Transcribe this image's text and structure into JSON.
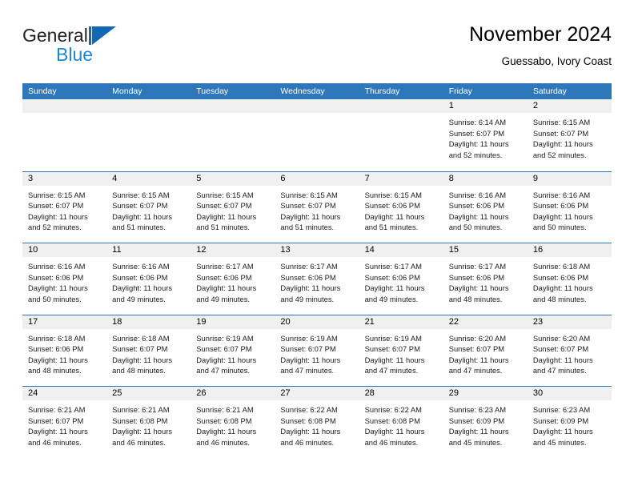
{
  "brand": {
    "name_part1": "General",
    "name_part2": "Blue",
    "logo_icon": "general-blue-triangle-logo",
    "accent_color": "#1268b3",
    "secondary_color": "#1e87d6"
  },
  "header": {
    "title": "November 2024",
    "subtitle": "Guessabo, Ivory Coast"
  },
  "calendar": {
    "header_bg": "#2e77bb",
    "header_text_color": "#ffffff",
    "datenum_bg": "#f0f0f0",
    "weekdays": [
      "Sunday",
      "Monday",
      "Tuesday",
      "Wednesday",
      "Thursday",
      "Friday",
      "Saturday"
    ],
    "weeks": [
      [
        {
          "day": "",
          "lines": []
        },
        {
          "day": "",
          "lines": []
        },
        {
          "day": "",
          "lines": []
        },
        {
          "day": "",
          "lines": []
        },
        {
          "day": "",
          "lines": []
        },
        {
          "day": "1",
          "lines": [
            "Sunrise: 6:14 AM",
            "Sunset: 6:07 PM",
            "Daylight: 11 hours",
            "and 52 minutes."
          ]
        },
        {
          "day": "2",
          "lines": [
            "Sunrise: 6:15 AM",
            "Sunset: 6:07 PM",
            "Daylight: 11 hours",
            "and 52 minutes."
          ]
        }
      ],
      [
        {
          "day": "3",
          "lines": [
            "Sunrise: 6:15 AM",
            "Sunset: 6:07 PM",
            "Daylight: 11 hours",
            "and 52 minutes."
          ]
        },
        {
          "day": "4",
          "lines": [
            "Sunrise: 6:15 AM",
            "Sunset: 6:07 PM",
            "Daylight: 11 hours",
            "and 51 minutes."
          ]
        },
        {
          "day": "5",
          "lines": [
            "Sunrise: 6:15 AM",
            "Sunset: 6:07 PM",
            "Daylight: 11 hours",
            "and 51 minutes."
          ]
        },
        {
          "day": "6",
          "lines": [
            "Sunrise: 6:15 AM",
            "Sunset: 6:07 PM",
            "Daylight: 11 hours",
            "and 51 minutes."
          ]
        },
        {
          "day": "7",
          "lines": [
            "Sunrise: 6:15 AM",
            "Sunset: 6:06 PM",
            "Daylight: 11 hours",
            "and 51 minutes."
          ]
        },
        {
          "day": "8",
          "lines": [
            "Sunrise: 6:16 AM",
            "Sunset: 6:06 PM",
            "Daylight: 11 hours",
            "and 50 minutes."
          ]
        },
        {
          "day": "9",
          "lines": [
            "Sunrise: 6:16 AM",
            "Sunset: 6:06 PM",
            "Daylight: 11 hours",
            "and 50 minutes."
          ]
        }
      ],
      [
        {
          "day": "10",
          "lines": [
            "Sunrise: 6:16 AM",
            "Sunset: 6:06 PM",
            "Daylight: 11 hours",
            "and 50 minutes."
          ]
        },
        {
          "day": "11",
          "lines": [
            "Sunrise: 6:16 AM",
            "Sunset: 6:06 PM",
            "Daylight: 11 hours",
            "and 49 minutes."
          ]
        },
        {
          "day": "12",
          "lines": [
            "Sunrise: 6:17 AM",
            "Sunset: 6:06 PM",
            "Daylight: 11 hours",
            "and 49 minutes."
          ]
        },
        {
          "day": "13",
          "lines": [
            "Sunrise: 6:17 AM",
            "Sunset: 6:06 PM",
            "Daylight: 11 hours",
            "and 49 minutes."
          ]
        },
        {
          "day": "14",
          "lines": [
            "Sunrise: 6:17 AM",
            "Sunset: 6:06 PM",
            "Daylight: 11 hours",
            "and 49 minutes."
          ]
        },
        {
          "day": "15",
          "lines": [
            "Sunrise: 6:17 AM",
            "Sunset: 6:06 PM",
            "Daylight: 11 hours",
            "and 48 minutes."
          ]
        },
        {
          "day": "16",
          "lines": [
            "Sunrise: 6:18 AM",
            "Sunset: 6:06 PM",
            "Daylight: 11 hours",
            "and 48 minutes."
          ]
        }
      ],
      [
        {
          "day": "17",
          "lines": [
            "Sunrise: 6:18 AM",
            "Sunset: 6:06 PM",
            "Daylight: 11 hours",
            "and 48 minutes."
          ]
        },
        {
          "day": "18",
          "lines": [
            "Sunrise: 6:18 AM",
            "Sunset: 6:07 PM",
            "Daylight: 11 hours",
            "and 48 minutes."
          ]
        },
        {
          "day": "19",
          "lines": [
            "Sunrise: 6:19 AM",
            "Sunset: 6:07 PM",
            "Daylight: 11 hours",
            "and 47 minutes."
          ]
        },
        {
          "day": "20",
          "lines": [
            "Sunrise: 6:19 AM",
            "Sunset: 6:07 PM",
            "Daylight: 11 hours",
            "and 47 minutes."
          ]
        },
        {
          "day": "21",
          "lines": [
            "Sunrise: 6:19 AM",
            "Sunset: 6:07 PM",
            "Daylight: 11 hours",
            "and 47 minutes."
          ]
        },
        {
          "day": "22",
          "lines": [
            "Sunrise: 6:20 AM",
            "Sunset: 6:07 PM",
            "Daylight: 11 hours",
            "and 47 minutes."
          ]
        },
        {
          "day": "23",
          "lines": [
            "Sunrise: 6:20 AM",
            "Sunset: 6:07 PM",
            "Daylight: 11 hours",
            "and 47 minutes."
          ]
        }
      ],
      [
        {
          "day": "24",
          "lines": [
            "Sunrise: 6:21 AM",
            "Sunset: 6:07 PM",
            "Daylight: 11 hours",
            "and 46 minutes."
          ]
        },
        {
          "day": "25",
          "lines": [
            "Sunrise: 6:21 AM",
            "Sunset: 6:08 PM",
            "Daylight: 11 hours",
            "and 46 minutes."
          ]
        },
        {
          "day": "26",
          "lines": [
            "Sunrise: 6:21 AM",
            "Sunset: 6:08 PM",
            "Daylight: 11 hours",
            "and 46 minutes."
          ]
        },
        {
          "day": "27",
          "lines": [
            "Sunrise: 6:22 AM",
            "Sunset: 6:08 PM",
            "Daylight: 11 hours",
            "and 46 minutes."
          ]
        },
        {
          "day": "28",
          "lines": [
            "Sunrise: 6:22 AM",
            "Sunset: 6:08 PM",
            "Daylight: 11 hours",
            "and 46 minutes."
          ]
        },
        {
          "day": "29",
          "lines": [
            "Sunrise: 6:23 AM",
            "Sunset: 6:09 PM",
            "Daylight: 11 hours",
            "and 45 minutes."
          ]
        },
        {
          "day": "30",
          "lines": [
            "Sunrise: 6:23 AM",
            "Sunset: 6:09 PM",
            "Daylight: 11 hours",
            "and 45 minutes."
          ]
        }
      ]
    ]
  }
}
